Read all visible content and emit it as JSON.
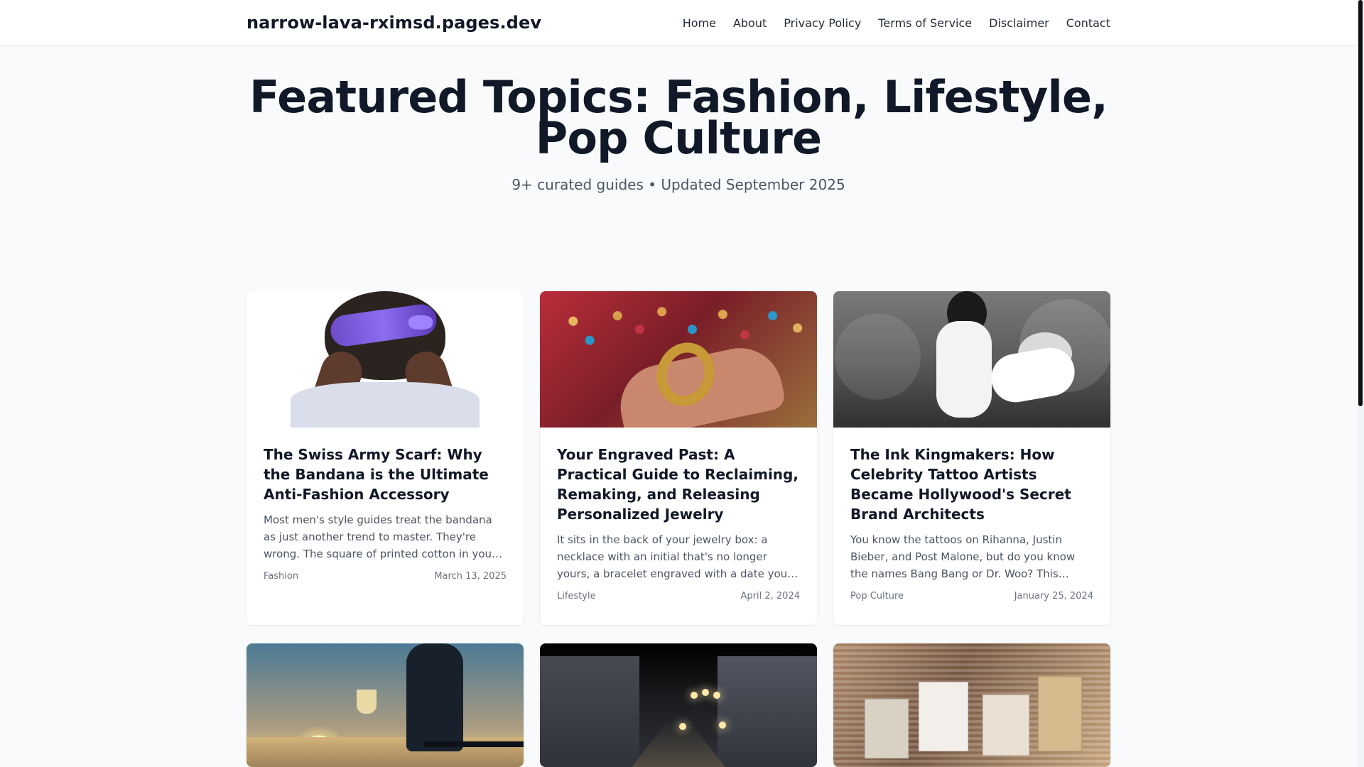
{
  "site": {
    "brand": "narrow-lava-rximsd.pages.dev",
    "nav": [
      "Home",
      "About",
      "Privacy Policy",
      "Terms of Service",
      "Disclaimer",
      "Contact"
    ]
  },
  "hero": {
    "title": "Featured Topics: Fashion, Lifestyle, Pop Culture",
    "subtitle": "9+ curated guides • Updated September 2025"
  },
  "cards": [
    {
      "title": "The Swiss Army Scarf: Why the Bandana is the Ultimate Anti-Fashion Accessory",
      "excerpt": "Most men's style guides treat the bandana as just another trend to master. They're wrong. The square of printed cotton in your pocket...",
      "category": "Fashion",
      "date": "March 13, 2025"
    },
    {
      "title": "Your Engraved Past: A Practical Guide to Reclaiming, Remaking, and Releasing Personalized Jewelry",
      "excerpt": "It sits in the back of your jewelry box: a necklace with an initial that's no longer yours, a bracelet engraved with a date you'd rathe...",
      "category": "Lifestyle",
      "date": "April 2, 2024"
    },
    {
      "title": "The Ink Kingmakers: How Celebrity Tattoo Artists Became Hollywood's Secret Brand Architects",
      "excerpt": "You know the tattoos on Rihanna, Justin Bieber, and Post Malone, but do you know the names Bang Bang or Dr. Woo? This isn't...",
      "category": "Pop Culture",
      "date": "January 25, 2024"
    },
    {},
    {},
    {}
  ],
  "colors": {
    "background": "#f8fafc",
    "text": "#111827",
    "muted": "#4b5563",
    "border": "#e2e8f0",
    "card": "#ffffff"
  }
}
